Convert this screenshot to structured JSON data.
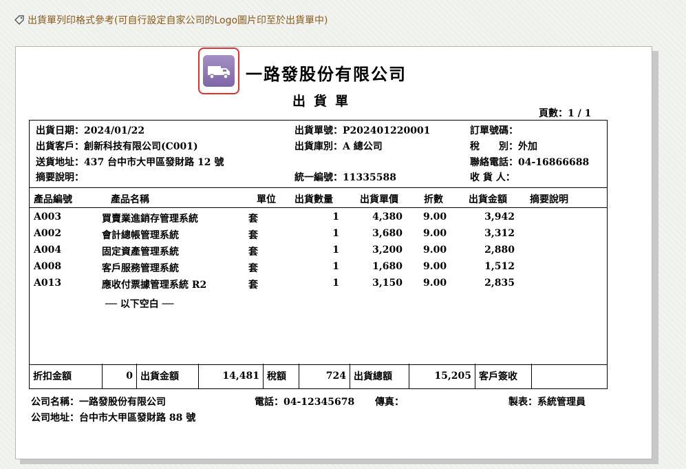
{
  "caption": "出貨單列印格式參考(可自行設定自家公司的Logo圖片印至於出貨單中)",
  "icons": {
    "caption_icon": "tag-icon",
    "logo_icon": "delivery-truck-icon"
  },
  "colors": {
    "caption": "#8a5a1b",
    "logo_border": "#e03030",
    "logo_fill": "#8c76b2"
  },
  "document": {
    "company_title": "一路發股份有限公司",
    "doc_title": "出貨單",
    "page_label": "頁數：",
    "page_value": "1 / 1"
  },
  "info": {
    "ship_date_label": "出貨日期：",
    "ship_date": "2024/01/22",
    "customer_label": "出貨客戶：",
    "customer": "創新科技有限公司(C001)",
    "address_label": "送貨地址：",
    "address": "437 台中市大甲區發財路 12 號",
    "summary_label": "摘要說明：",
    "summary": "",
    "ship_no_label": "出貨單號：",
    "ship_no": "P202401220001",
    "warehouse_label": "出貨庫別：",
    "warehouse": "A 總公司",
    "tax_id_label": "統一編號：",
    "tax_id": "11335588",
    "order_no_label": "訂單號碼：",
    "order_no": "",
    "tax_label": "稅　　別：",
    "tax": "外加",
    "phone_label": "聯絡電話：",
    "phone": "04-16866688",
    "receiver_label": "收 貨 人：",
    "receiver": ""
  },
  "table": {
    "headers": {
      "code": "產品編號",
      "name": "產品名稱",
      "unit": "單位",
      "qty": "出貨數量",
      "price": "出貨單價",
      "discount": "折數",
      "amount": "出貨金額",
      "note": "摘要說明"
    },
    "rows": [
      {
        "code": "A003",
        "name": "買賣業進銷存管理系統",
        "unit": "套",
        "qty": "1",
        "price": "4,380",
        "discount": "9.00",
        "amount": "3,942",
        "note": ""
      },
      {
        "code": "A002",
        "name": "會計總帳管理系統",
        "unit": "套",
        "qty": "1",
        "price": "3,680",
        "discount": "9.00",
        "amount": "3,312",
        "note": ""
      },
      {
        "code": "A004",
        "name": "固定資產管理系統",
        "unit": "套",
        "qty": "1",
        "price": "3,200",
        "discount": "9.00",
        "amount": "2,880",
        "note": ""
      },
      {
        "code": "A008",
        "name": "客戶服務管理系統",
        "unit": "套",
        "qty": "1",
        "price": "1,680",
        "discount": "9.00",
        "amount": "1,512",
        "note": ""
      },
      {
        "code": "A013",
        "name": "應收付票據管理系統 R2",
        "unit": "套",
        "qty": "1",
        "price": "3,150",
        "discount": "9.00",
        "amount": "2,835",
        "note": ""
      }
    ],
    "blank_marker": "── 以下空白 ──"
  },
  "totals": {
    "discount_label": "折扣金額",
    "discount": "0",
    "amount_label": "出貨金額",
    "amount": "14,481",
    "tax_label": "稅額",
    "tax": "724",
    "total_label": "出貨總額",
    "total": "15,205",
    "sign_label": "客戶簽收",
    "sign": ""
  },
  "footer": {
    "company_label": "公司名稱：",
    "company": "一路發股份有限公司",
    "phone_label": "電話：",
    "phone": "04-12345678",
    "fax_label": "傳真：",
    "fax": "",
    "maker_label": "製表：",
    "maker": "系統管理員",
    "address_label": "公司地址：",
    "address": "台中市大甲區發財路 88 號"
  }
}
